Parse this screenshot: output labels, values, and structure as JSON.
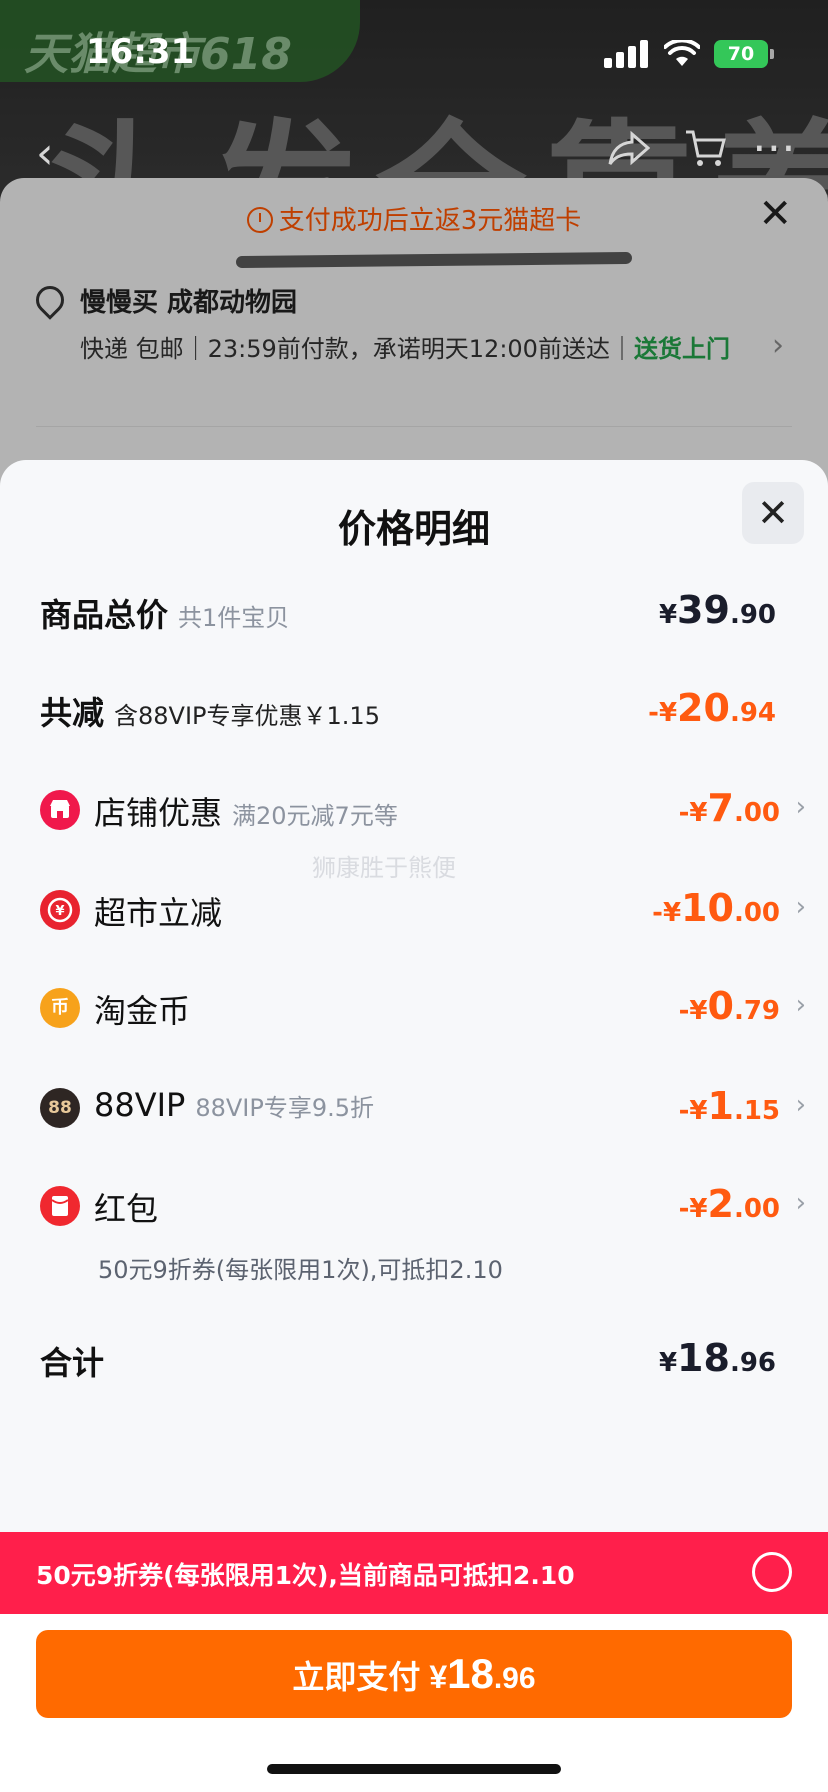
{
  "status_bar": {
    "time": "16:31",
    "battery": "70"
  },
  "background": {
    "promo_tag": "天猫超市618",
    "banner_text": "头发全靠养",
    "cashback_text": "支付成功后立返3元猫超卡",
    "address_title": "慢慢买 成都动物园",
    "delivery_prefix": "快递 包邮｜23:59前付款，承诺明天12:00前送达｜",
    "delivery_highlight": "送货上门"
  },
  "sheet": {
    "title": "价格明细",
    "rows": {
      "total_price": {
        "label": "商品总价",
        "sub": "共1件宝贝",
        "symbol": "¥",
        "int": "39",
        "dec": ".90"
      },
      "total_discount": {
        "label": "共减",
        "sub": "含88VIP专享优惠￥1.15",
        "symbol": "-¥",
        "int": "20",
        "dec": ".94"
      },
      "store_discount": {
        "label": "店铺优惠",
        "sub": "满20元减7元等",
        "symbol": "-¥",
        "int": "7",
        "dec": ".00",
        "icon": "store-icon"
      },
      "market_discount": {
        "label": "超市立减",
        "sub": "",
        "symbol": "-¥",
        "int": "10",
        "dec": ".00",
        "icon": "yuan-coupon-icon"
      },
      "gold_coin": {
        "label": "淘金币",
        "sub": "",
        "symbol": "-¥",
        "int": "0",
        "dec": ".79",
        "icon": "coin-icon",
        "icon_glyph": "币"
      },
      "vip": {
        "label": "88VIP",
        "sub": "88VIP专享9.5折",
        "symbol": "-¥",
        "int": "1",
        "dec": ".15",
        "icon": "vip-88-icon",
        "icon_glyph": "88"
      },
      "red_packet": {
        "label": "红包",
        "sub": "",
        "symbol": "-¥",
        "int": "2",
        "dec": ".00",
        "icon": "red-packet-icon",
        "note": "50元9折券(每张限用1次),可抵扣2.10"
      },
      "subtotal": {
        "label": "合计",
        "symbol": "¥",
        "int": "18",
        "dec": ".96"
      }
    }
  },
  "watermark": "狮康胜于熊便",
  "coupon_bar": {
    "text": "50元9折券(每张限用1次),当前商品可抵扣2.10"
  },
  "pay_button": {
    "label": "立即支付 ¥",
    "int": "18",
    "dec": ".96"
  },
  "colors": {
    "accent_orange": "#ff6a00",
    "discount_orange": "#ff5a10",
    "coupon_red": "#ff1f4b",
    "green": "#23a04a"
  }
}
